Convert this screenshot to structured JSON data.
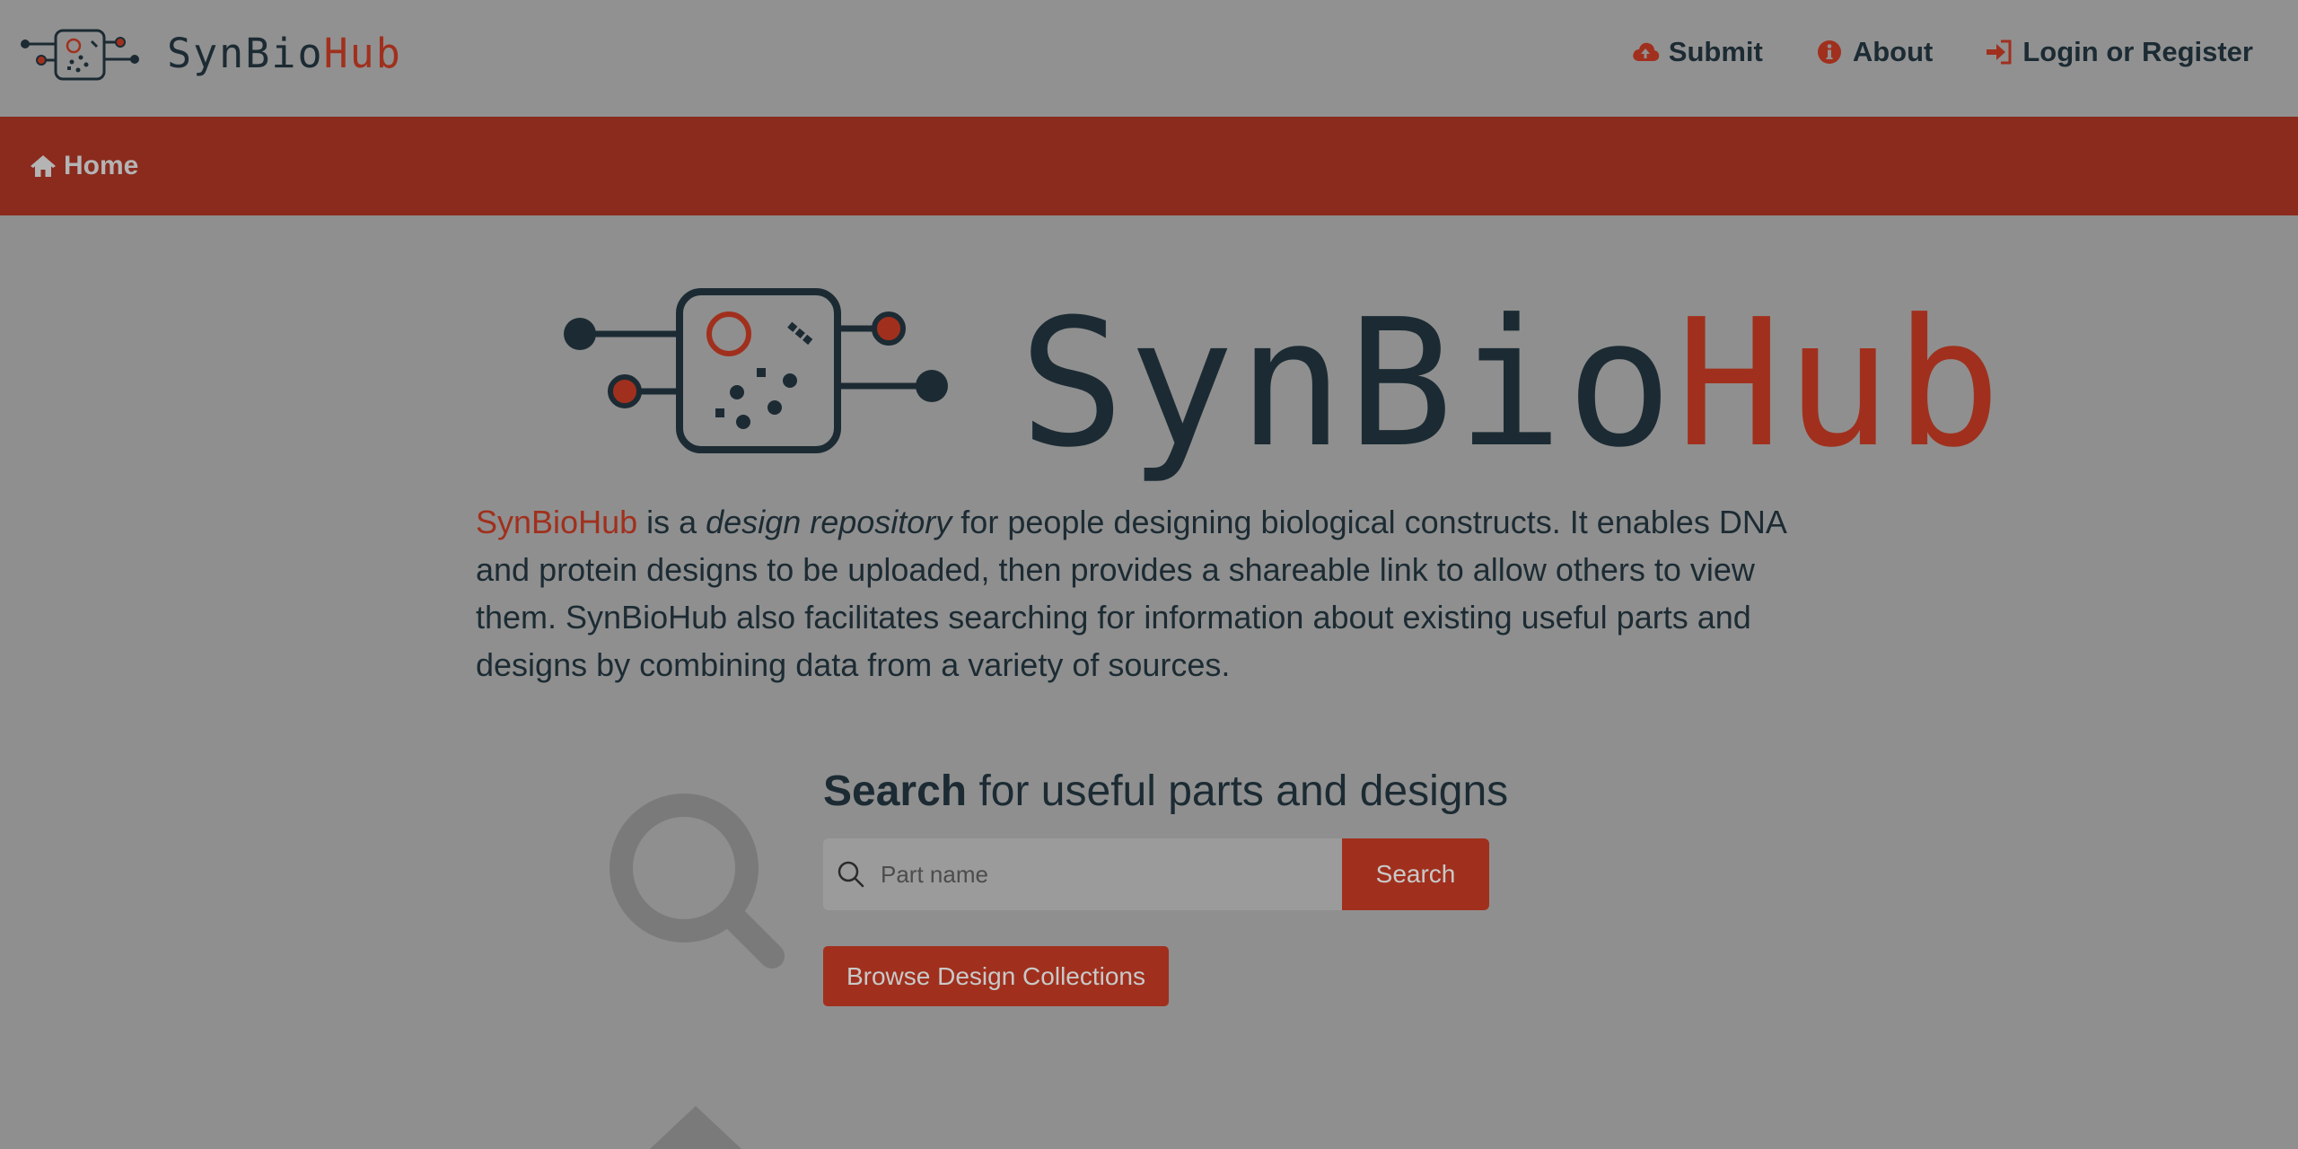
{
  "brand": {
    "name_prefix": "SynBio",
    "name_suffix": "Hub"
  },
  "nav": {
    "items": [
      {
        "label": "Submit",
        "icon": "cloud-upload-icon"
      },
      {
        "label": "About",
        "icon": "info-circle-icon"
      },
      {
        "label": "Login or Register",
        "icon": "sign-in-icon"
      }
    ]
  },
  "breadcrumb": {
    "home_label": "Home",
    "icon": "home-icon"
  },
  "hero": {
    "title_prefix": "SynBio",
    "title_suffix": "Hub"
  },
  "intro": {
    "brand": "SynBioHub",
    "part1": " is a ",
    "emphasis": "design repository",
    "part2": " for people designing biological constructs. It enables DNA and protein designs to be uploaded, then provides a shareable link to allow others to view them. SynBioHub also facilitates searching for information about existing useful parts and designs by combining data from a variety of sources."
  },
  "search": {
    "heading_bold": "Search",
    "heading_rest": " for useful parts and designs",
    "placeholder": "Part name",
    "value": "",
    "button_label": "Search",
    "browse_label": "Browse Design Collections"
  },
  "colors": {
    "accent": "#a0301d",
    "red_bar": "#8a2b1d",
    "text_dark": "#1c2b33",
    "background": "#8f8f8f"
  }
}
